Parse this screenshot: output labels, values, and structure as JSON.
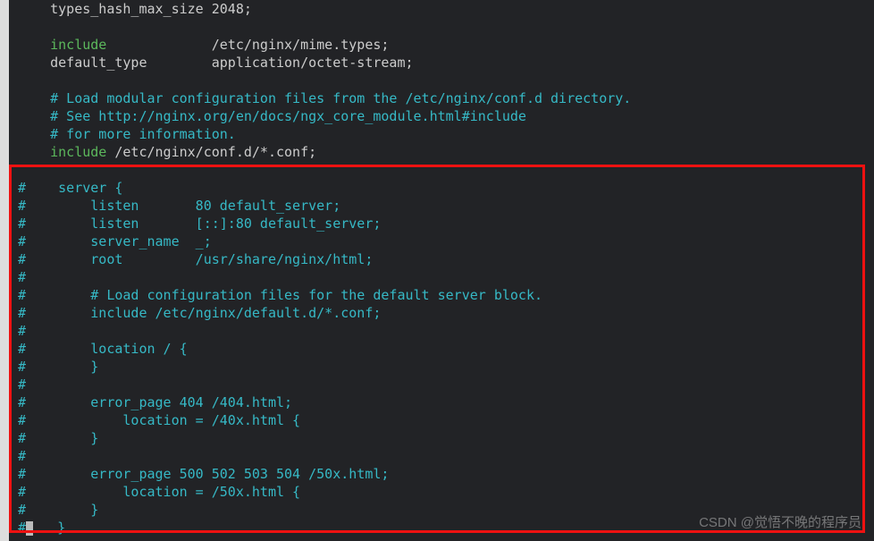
{
  "code": {
    "l00": "    types_hash_max_size 2048;",
    "l01": "",
    "l02_kw": "    include",
    "l02_rest": "             /etc/nginx/mime.types;",
    "l03": "    default_type        application/octet-stream;",
    "l04": "",
    "l05": "    # Load modular configuration files from the /etc/nginx/conf.d directory.",
    "l06": "    # See http://nginx.org/en/docs/ngx_core_module.html#include",
    "l07": "    # for more information.",
    "l08_kw": "    include",
    "l08_rest": " /etc/nginx/conf.d/*.conf;",
    "l09": "",
    "l10": "#    server {",
    "l11": "#        listen       80 default_server;",
    "l12": "#        listen       [::]:80 default_server;",
    "l13": "#        server_name  _;",
    "l14": "#        root         /usr/share/nginx/html;",
    "l15": "#",
    "l16": "#        # Load configuration files for the default server block.",
    "l17": "#        include /etc/nginx/default.d/*.conf;",
    "l18": "#",
    "l19": "#        location / {",
    "l20": "#        }",
    "l21": "#",
    "l22": "#        error_page 404 /404.html;",
    "l23": "#            location = /40x.html {",
    "l24": "#        }",
    "l25": "#",
    "l26": "#        error_page 500 502 503 504 /50x.html;",
    "l27": "#            location = /50x.html {",
    "l28": "#        }",
    "l29a": "#",
    "l29b": "   }"
  },
  "watermark": "CSDN @觉悟不晚的程序员"
}
